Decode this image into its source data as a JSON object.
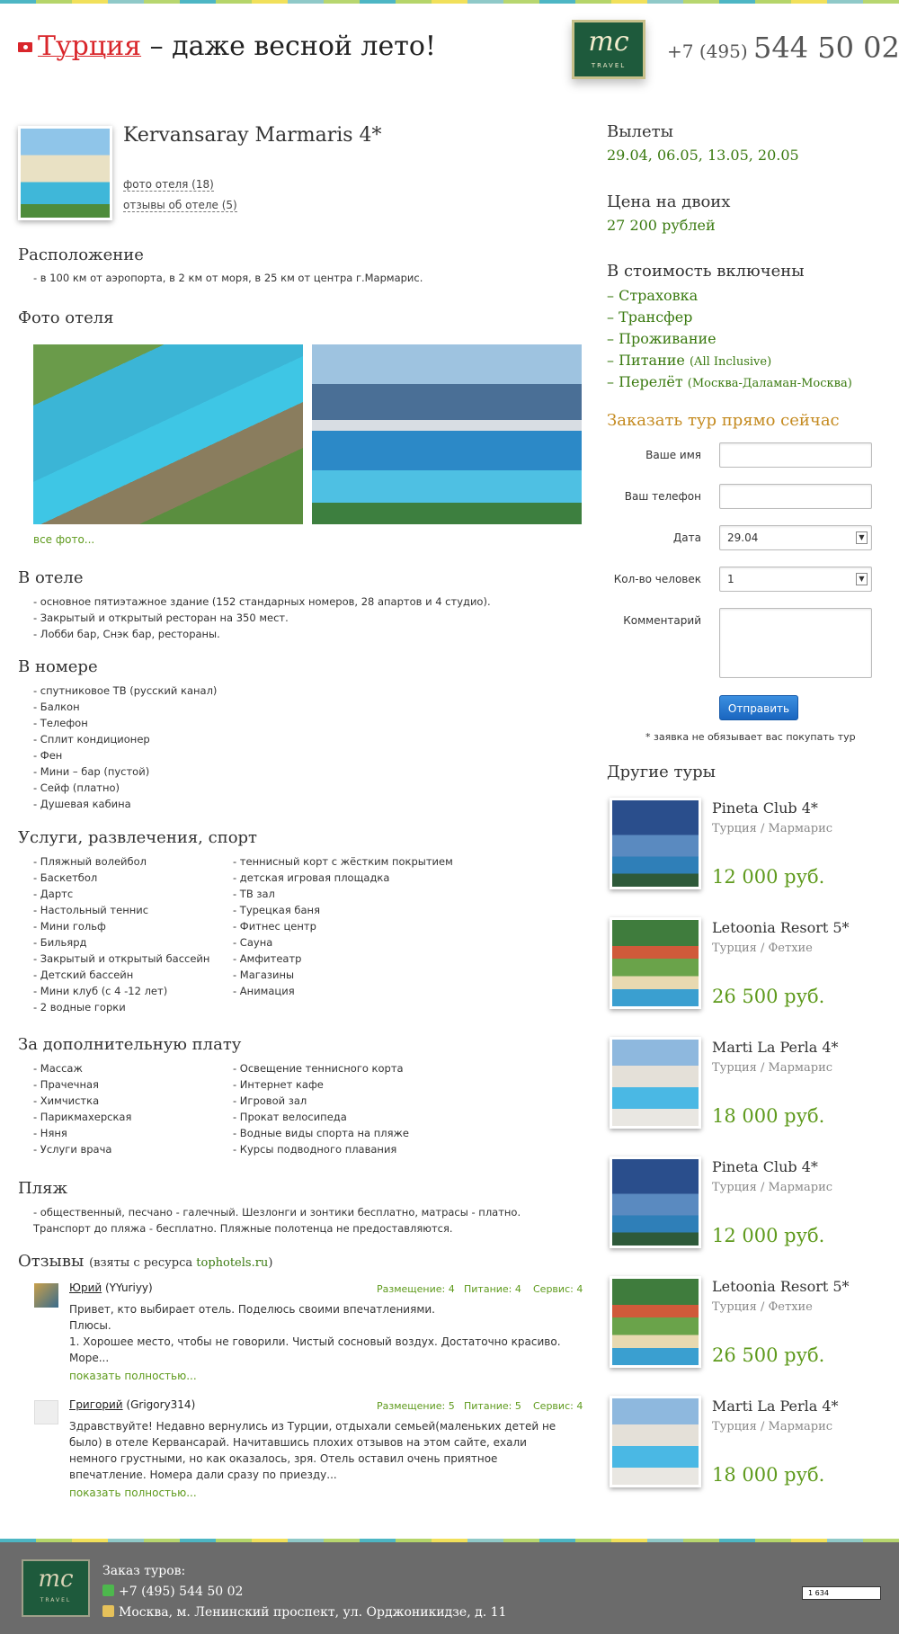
{
  "header": {
    "country": "Турция",
    "slogan": " – даже весной лето!",
    "logo_mark": "mc",
    "logo_sub": "TRAVEL",
    "phone_code": "+7 (495) ",
    "phone_number": "544 50 02"
  },
  "hotel": {
    "title": "Kervansaray Marmaris 4*",
    "photos_link": "фото отеля (18)",
    "reviews_link": "отзывы об отеле (5)"
  },
  "location": {
    "heading": "Расположение",
    "text": "- в 100 км от аэропорта, в 2 км от моря, в 25 км от центра г.Мармарис."
  },
  "photos": {
    "heading": "Фото отеля",
    "all_link": "все фото..."
  },
  "in_hotel": {
    "heading": "В отеле",
    "items": [
      "- основное пятиэтажное здание (152 стандарных номеров, 28 апартов и 4 студио).",
      "- Закрытый и открытый ресторан на 350 мест.",
      "- Лобби бар, Снэк бар, рестораны."
    ]
  },
  "in_room": {
    "heading": "В номере",
    "items": [
      "- спутниковое ТВ (русский канал)",
      "- Балкон",
      "- Телефон",
      "- Сплит кондиционер",
      "- Фен",
      "- Мини – бар (пустой)",
      "- Сейф (платно)",
      "- Душевая кабина"
    ]
  },
  "services": {
    "heading": "Услуги, развлечения, спорт",
    "col1": [
      "- Пляжный волейбол",
      "- Баскетбол",
      "- Дартс",
      "- Настольный теннис",
      "- Мини гольф",
      "- Бильярд",
      "- Закрытый и открытый бассейн",
      "- Детский бассейн",
      "- Мини клуб (с 4 -12 лет)",
      "- 2 водные горки"
    ],
    "col2": [
      "- теннисный корт с жёстким покрытием",
      "- детская игровая площадка",
      "- ТВ зал",
      "- Турецкая баня",
      "- Фитнес центр",
      "- Сауна",
      "- Амфитеатр",
      "- Магазины",
      "- Анимация"
    ]
  },
  "extra": {
    "heading": "За дополнительную плату",
    "col1": [
      "- Массаж",
      "- Прачечная",
      "- Химчистка",
      "- Парикмахерская",
      "- Няня",
      "- Услуги врача"
    ],
    "col2": [
      "- Освещение теннисного корта",
      "- Интернет кафе",
      "- Игровой зал",
      "- Прокат велосипеда",
      "- Водные виды спорта на пляже",
      "- Курсы подводного плавания"
    ]
  },
  "beach": {
    "heading": "Пляж",
    "text": "- общественный, песчано - галечный. Шезлонги и зонтики бесплатно, матрасы - платно. Транспорт до пляжа - бесплатно. Пляжные полотенца не предоставляются."
  },
  "reviews": {
    "heading": "Отзывы",
    "source_prefix": "(взяты с ресурса ",
    "source_link": "tophotels.ru",
    "source_suffix": ")",
    "items": [
      {
        "name": "Юрий",
        "nick": " (YYuriyy)",
        "score_place": "Размещение: 4",
        "score_food": "Питание: 4",
        "score_service": "Сервис: 4",
        "text": "Привет, кто выбирает отель. Поделюсь своими впечатлениями.\nПлюсы.\n1. Хорошее место, чтобы не говорили. Чистый сосновый воздух. Достаточно красиво. Море...",
        "more": "показать полностью..."
      },
      {
        "name": "Григорий",
        "nick": " (Grigory314)",
        "score_place": "Размещение: 5",
        "score_food": "Питание: 5",
        "score_service": "Сервис: 4",
        "text": "Здравствуйте! Недавно вернулись из Турции, отдыхали семьей(маленьких детей не было) в отеле Кервансарай. Начитавшись плохих отзывов на этом сайте, ехали немного грустными, но как оказалось, зря. Отель оставил очень приятное впечатление. Номера дали сразу по приезду...",
        "more": "показать полностью..."
      }
    ]
  },
  "flights": {
    "heading": "Вылеты",
    "dates": "29.04, 06.05, 13.05, 20.05"
  },
  "price": {
    "heading": "Цена на двоих",
    "value": "27 200 рублей"
  },
  "included": {
    "heading": "В стоимость включены",
    "items": [
      {
        "label": "– Страховка",
        "note": ""
      },
      {
        "label": "– Трансфер",
        "note": ""
      },
      {
        "label": "– Проживание",
        "note": ""
      },
      {
        "label": "– Питание ",
        "note": "(All Inclusive)"
      },
      {
        "label": "– Перелёт ",
        "note": "(Москва-Даламан-Москва)"
      }
    ]
  },
  "order": {
    "heading": "Заказать тур прямо сейчас",
    "name_label": "Ваше имя",
    "phone_label": "Ваш телефон",
    "date_label": "Дата",
    "date_value": "29.04",
    "people_label": "Кол-во человек",
    "people_value": "1",
    "comment_label": "Комментарий",
    "submit": "Отправить",
    "note": "* заявка не обязывает вас покупать тур"
  },
  "other_tours": {
    "heading": "Другие туры",
    "items": [
      {
        "name": "Pineta Club 4*",
        "location": "Турция / Мармарис",
        "price": "12 000 руб."
      },
      {
        "name": "Letoonia Resort 5*",
        "location": "Турция / Фетхие",
        "price": "26 500 руб."
      },
      {
        "name": "Marti La Perla 4*",
        "location": "Турция / Мармарис",
        "price": "18 000 руб."
      },
      {
        "name": "Pineta Club 4*",
        "location": "Турция / Мармарис",
        "price": "12 000 руб."
      },
      {
        "name": "Letoonia Resort 5*",
        "location": "Турция / Фетхие",
        "price": "26 500 руб."
      },
      {
        "name": "Marti La Perla 4*",
        "location": "Турция / Мармарис",
        "price": "18 000 руб."
      }
    ]
  },
  "footer": {
    "title": "Заказ туров:",
    "phone": "+7 (495) 544 50 02",
    "address": "Москва, м. Ленинский проспект, ул. Орджоникидзе, д. 11",
    "counter": "1 634"
  }
}
